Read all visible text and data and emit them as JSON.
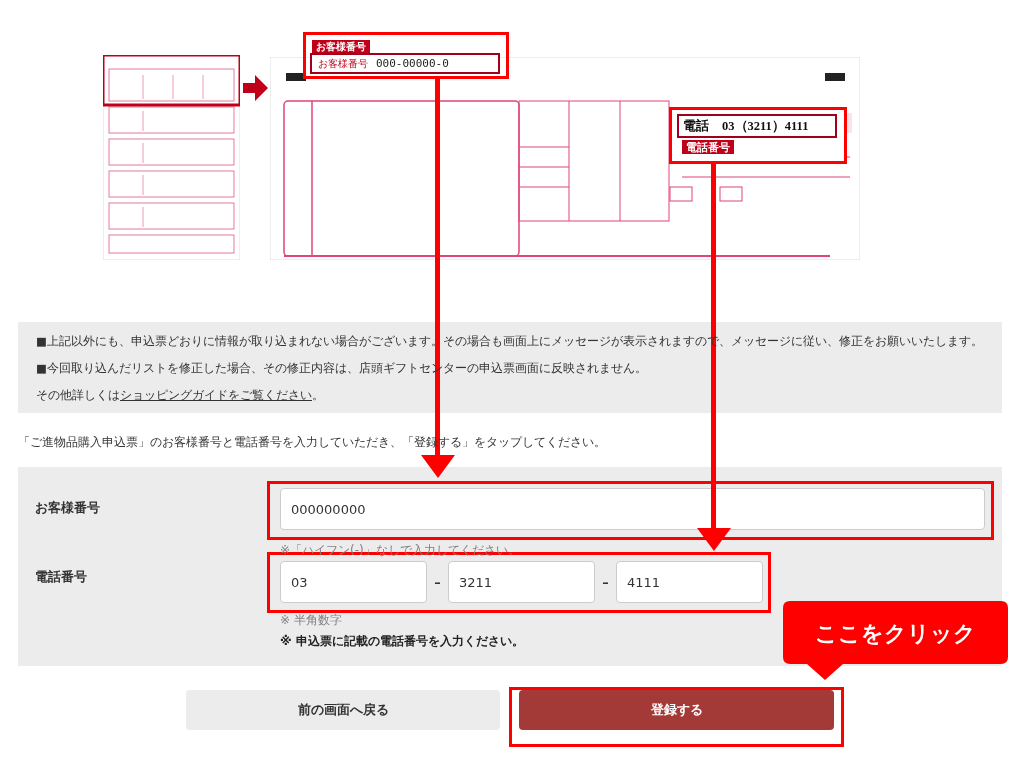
{
  "annotations": {
    "customer_callout": {
      "tag": "お客様番号",
      "label": "お客様番号",
      "value": "000-00000-0"
    },
    "phone_callout": {
      "value": "電話　03（3211）4111",
      "tag": "電話番号"
    },
    "click_bubble": "ここをクリック"
  },
  "notices": [
    "■上記以外にも、申込票どおりに情報が取り込まれない場合がございます。その場合も画面上にメッセージが表示されますので、メッセージに従い、修正をお願いいたします。",
    "■今回取り込んだリストを修正した場合、その修正内容は、店頭ギフトセンターの申込票画面に反映されません。"
  ],
  "more_info": {
    "before": "その他詳しくは",
    "link": "ショッピングガイドをご覧ください",
    "after": "。"
  },
  "instruction": "「ご進物品購入申込票」のお客様番号と電話番号を入力していただき、「登録する」をタップしてください。",
  "form": {
    "customer_number": {
      "label": "お客様番号",
      "value": "000000000",
      "note": "※「ハイフン(-)」なしで入力してください。"
    },
    "phone": {
      "label": "電話番号",
      "parts": [
        "03",
        "3211",
        "4111"
      ],
      "separators": [
        "–",
        "–"
      ],
      "notes": [
        {
          "text": "※ 半角数字",
          "kind": "hint"
        },
        {
          "text": "※ 申込票に記載の電話番号を入力ください。",
          "kind": "emphasis"
        }
      ]
    }
  },
  "buttons": [
    {
      "label": "前の画面へ戻る",
      "kind": "secondary"
    },
    {
      "label": "登録する",
      "kind": "primary"
    }
  ]
}
